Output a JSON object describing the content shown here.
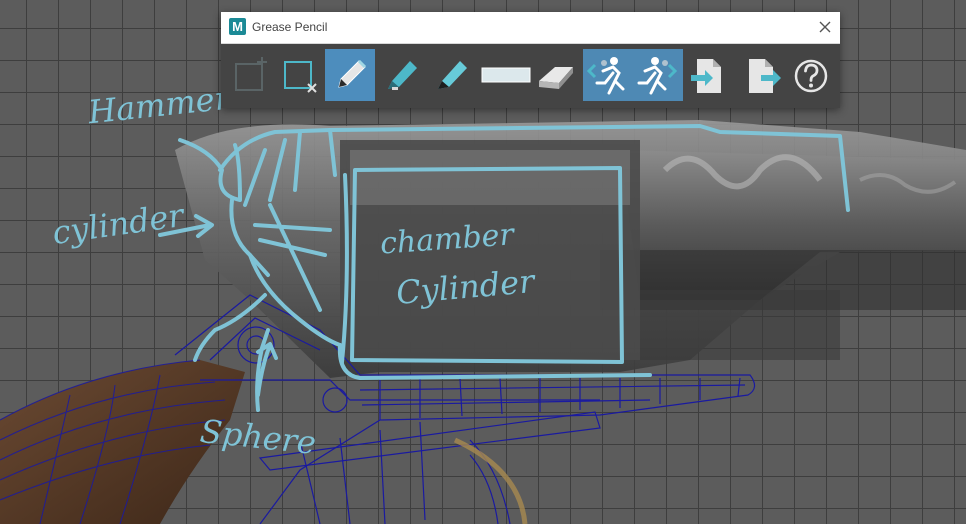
{
  "window": {
    "title": "Grease Pencil",
    "app_badge": "M",
    "close_icon": "close-icon"
  },
  "toolbar": {
    "tools": [
      {
        "name": "add-frame-tool",
        "icon": "add-frame-icon",
        "state": "disabled"
      },
      {
        "name": "delete-frame-tool",
        "icon": "delete-frame-icon",
        "state": "normal"
      },
      {
        "name": "pencil-tool",
        "icon": "pencil-icon",
        "state": "active"
      },
      {
        "name": "marker-tool",
        "icon": "marker-icon",
        "state": "normal"
      },
      {
        "name": "soft-pencil-tool",
        "icon": "soft-pencil-icon",
        "state": "normal"
      },
      {
        "name": "brush-opacity-tool",
        "icon": "stroke-bar-icon",
        "state": "normal"
      },
      {
        "name": "eraser-tool",
        "icon": "eraser-icon",
        "state": "normal"
      },
      {
        "name": "ghost-previous-tool",
        "icon": "ghost-previous-icon",
        "state": "toggled"
      },
      {
        "name": "ghost-next-tool",
        "icon": "ghost-next-icon",
        "state": "toggled"
      },
      {
        "name": "import-tool",
        "icon": "import-icon",
        "state": "normal"
      },
      {
        "name": "export-tool",
        "icon": "export-icon",
        "state": "normal"
      },
      {
        "name": "help-tool",
        "icon": "help-icon",
        "state": "normal"
      }
    ]
  },
  "annotations": {
    "hammer": "Hammer",
    "cylinder_left": "cylinder",
    "chamber": "chamber",
    "cylinder_main": "Cylinder",
    "sphere": "Sphere"
  },
  "colors": {
    "sketch": "#7fc3d6",
    "accent": "#4d8dbd",
    "wireframe": "#1a1aa0",
    "grip": "#5a3a26"
  }
}
